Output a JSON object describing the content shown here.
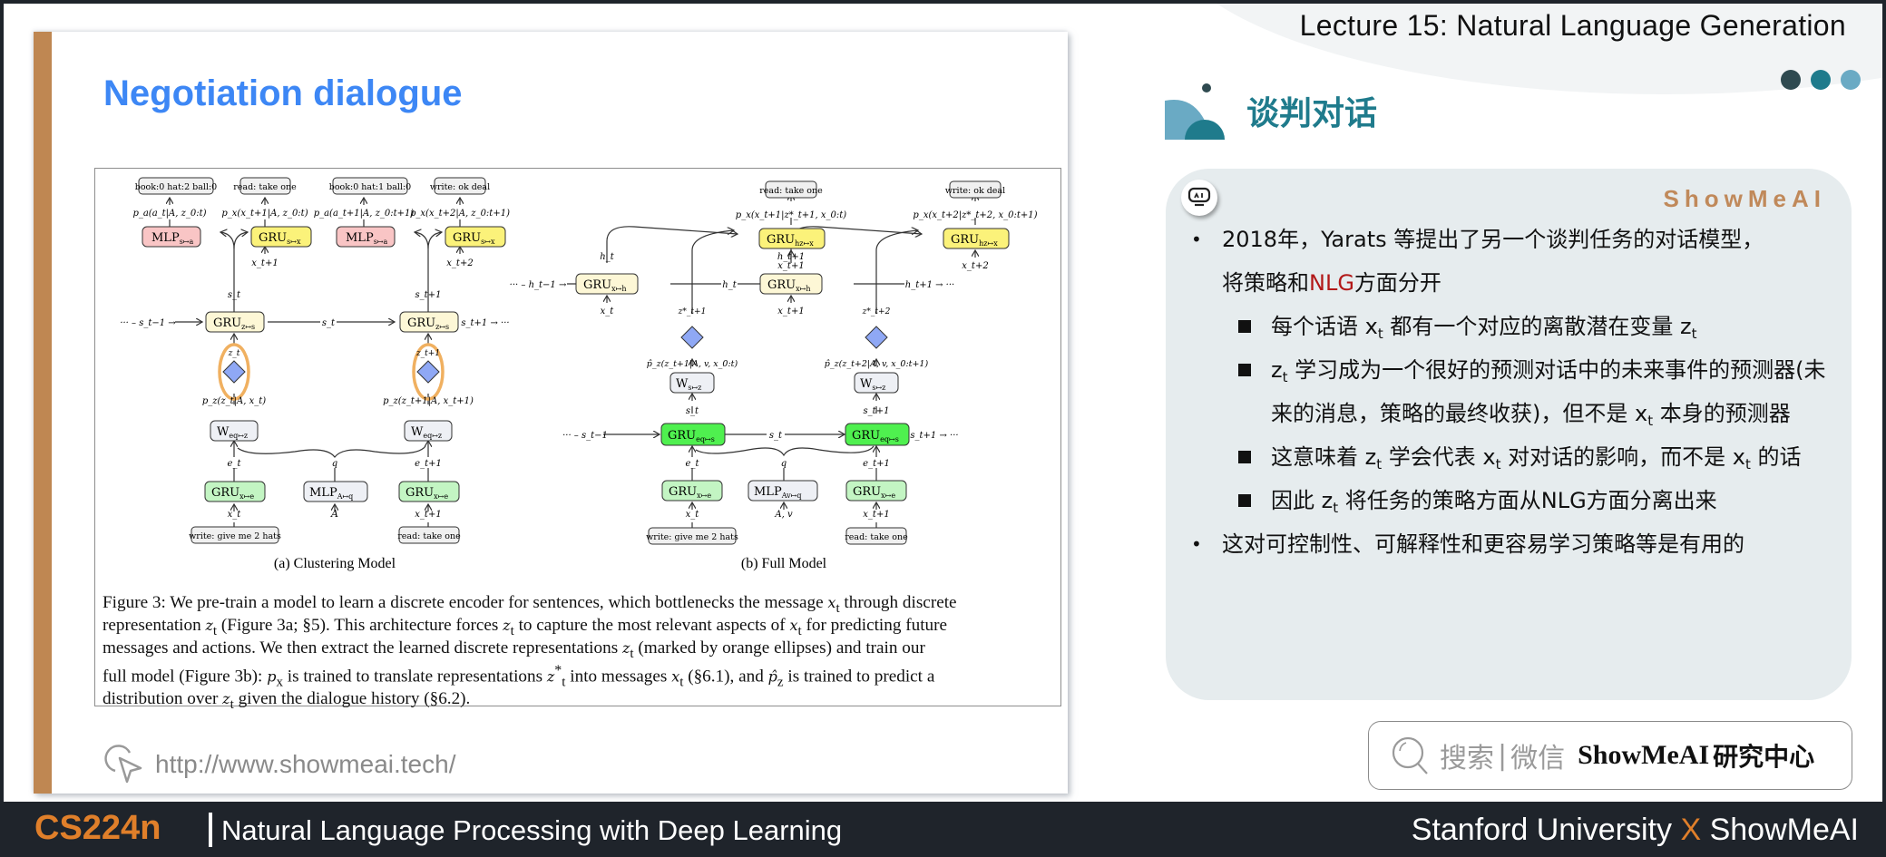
{
  "header": {
    "lecture_title": "Lecture 15: Natural Language Generation",
    "decor_dots": [
      "#2f4a50",
      "#1f7b8c",
      "#6aaac4"
    ]
  },
  "slide": {
    "title": "Negotiation dialogue",
    "title_color": "#3d87f5",
    "accent_bar_color": "#bf8752",
    "url": "http://www.showmeai.tech/",
    "figure": {
      "clustering": {
        "subcaption": "(a) Clustering Model",
        "outputs": [
          {
            "bold": "book:",
            "rest": "0 ",
            "bold2": "hat:",
            "rest2": "2 ",
            "bold3": "ball:",
            "rest3": "0"
          },
          {
            "bold": "read:",
            "rest": " take one"
          },
          {
            "bold": "book:",
            "rest": "0 ",
            "bold2": "hat:",
            "rest2": "1 ",
            "bold3": "ball:",
            "rest3": "0"
          },
          {
            "bold": "write:",
            "rest": " ok deal"
          }
        ],
        "output_labels": [
          "book:0 hat:2 ball:0",
          "read: take one",
          "book:0 hat:1 ball:0",
          "write: ok deal"
        ],
        "prob_labels": [
          "p_a(a_t|A, z_0:t)",
          "p_x(x_t+1|A, z_0:t)",
          "p_a(a_t+1|A, z_0:t+1)",
          "p_x(x_t+2|A, z_0:t+1)"
        ],
        "mlp_sa": "MLP",
        "mlp_sa_sub": "s↦a",
        "gru_sx": "GRU",
        "gru_sx_sub": "s↦x",
        "gru_zs_sub": "z↦s",
        "w_eqz_sub": "eq↦z",
        "gru_xe_sub": "x↦e",
        "mlp_aq_sub": "A↦q",
        "inputs": [
          "write: give me 2 hats",
          "read: take one"
        ],
        "vars": {
          "x_t1": "x_t+1",
          "x_t2": "x_t+2",
          "s_t": "s_t",
          "s_t1": "s_t+1",
          "s_prev": "··· – s_t−1 →",
          "s_next": "s_t+1 → ···",
          "z_t": "z_t",
          "z_t1": "z_t+1",
          "pz_t": "p_z(z_t|A, x_t)",
          "pz_t1": "p_z(z_t+1|A, x_t+1)",
          "e_t": "e_t",
          "e_t1": "e_t+1",
          "q": "q",
          "A": "A",
          "x_t": "x_t"
        }
      },
      "full": {
        "subcaption": "(b) Full Model",
        "output_labels": [
          "read: take one",
          "write: ok deal"
        ],
        "prob_labels": [
          "p_x(x_t+1|z*_t+1, x_0:t)",
          "p_x(x_t+2|z*_t+2, x_0:t+1)"
        ],
        "gru_hzx_sub": "hz↦x",
        "gru_xh_sub": "x↦h",
        "w_sz_sub": "s↦z",
        "gru_eqs_sub": "eq↦s",
        "gru_xe_sub": "x↦e",
        "mlp_avq_sub": "Av↦q",
        "inputs": [
          "write: give me 2 hats",
          "read: take one"
        ],
        "pz_labels": [
          "p̂_z(z_t+1|A, v, x_0:t)",
          "p̂_z(z_t+2|A, v, x_0:t+1)"
        ],
        "vars": {
          "h_prev": "··· – h_t−1 →",
          "h_t": "h_t",
          "h_t1": "h_t+1",
          "h_next": "h_t+1 → ···",
          "z_star_1": "z*_t+1",
          "z_star_2": "z*_t+2",
          "s_prev": "··· – s_t−1",
          "s_t": "s_t",
          "s_t1": "s_t+1",
          "s_next": "s_t+1 → ···",
          "Av": "A, v"
        }
      },
      "caption_lines": [
        "Figure 3: We pre-train a model to learn a discrete encoder for sentences, which bottlenecks the message x_t through discrete",
        "representation z_t (Figure 3a; §5). This architecture forces z_t to capture the most relevant aspects of x_t for predicting future",
        "messages and actions. We then extract the learned discrete representations z_t (marked by orange ellipses) and train our",
        "full model (Figure 3b): p_x is trained to translate representations z*_t into messages x_t (§6.1), and p̂_z is trained to predict a",
        "distribution over z_t given the dialogue history (§6.2)."
      ],
      "caption": {
        "l1a": "Figure 3:  We pre-train a model to learn a discrete encoder for sentences, which bottlenecks the message ",
        "l1b": " through discrete",
        "l2a": "representation ",
        "l2b": " (Figure 3a; §5). This architecture forces ",
        "l2c": " to capture the most relevant aspects of ",
        "l2d": " for predicting future",
        "l3a": "messages and actions.  We then extract the learned discrete representations ",
        "l3b": " (marked by orange ellipses) and train our",
        "l4a": "full model (Figure 3b): ",
        "l4b": " is trained to translate representations ",
        "l4c": " into messages ",
        "l4d": " (§6.1), and ",
        "l4e": " is trained to predict a",
        "l5a": "distribution over ",
        "l5b": " given the dialogue history (§6.2).",
        "xt": "x",
        "zt": "z",
        "px": "p",
        "pz": "p̂",
        "sub_t": "t",
        "sub_x": "x",
        "sub_z": "z",
        "star": "*"
      }
    }
  },
  "right_panel": {
    "section_title": "谈判对话",
    "brand": "ShowMeAI",
    "bullets": [
      {
        "level": 1,
        "parts": [
          "2018年，Yarats 等提出了另一个谈判任务的对话模型，",
          "将策略和",
          "NLG",
          "方面分开"
        ]
      },
      {
        "level": 2,
        "parts": [
          "每个话语 x",
          "t",
          " 都有一个对应的离散潜在变量 z",
          "t"
        ]
      },
      {
        "level": 2,
        "parts": [
          "z",
          "t",
          "  学习成为一个很好的预测对话中的未来事件的预测器(未来的消息，策略的最终收获)，但不是  x",
          "t",
          "  本身的预测器"
        ]
      },
      {
        "level": 2,
        "parts": [
          "这意味着 z",
          "t",
          " 学会代表 x",
          "t",
          " 对对话的影响，而不是 x",
          "t",
          " 的话"
        ]
      },
      {
        "level": 2,
        "parts": [
          "因此 z",
          "t",
          " 将任务的策略方面从NLG方面分离出来"
        ]
      },
      {
        "level": 1,
        "parts": [
          "这对可控制性、可解释性和更容易学习策略等是有用的"
        ]
      }
    ],
    "highlight_color": "#b21818",
    "search": {
      "label": "搜索",
      "separator": "|",
      "label2": "微信",
      "brand": "ShowMeAI",
      "brand_suffix": "研究中心"
    }
  },
  "footer": {
    "course_code": "CS224n",
    "course_name": "Natural Language Processing with Deep Learning",
    "partner_left": "Stanford University",
    "partner_x": "X",
    "partner_right": "ShowMeAI",
    "accent_color": "#e07f2a"
  }
}
